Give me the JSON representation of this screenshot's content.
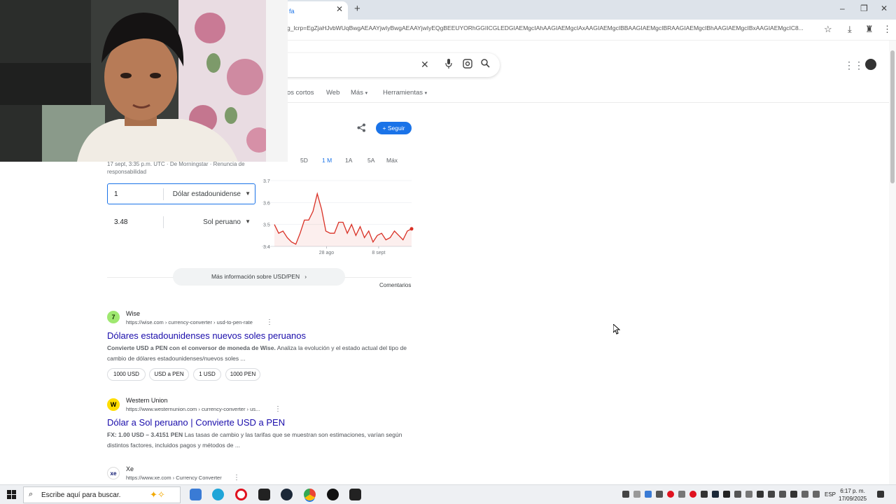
{
  "browser": {
    "tab_title": "fa",
    "url": "g_lcrp=EgZjaHJvbWUqBwgAEAAYjwIyBwgAEAAYjwIyEQgBEEUYORhGGIICGLEDGIAEMgcIAhAAGIAEMgcIAxAAGIAEMgcIBBAAGIAEMgcIBRAAGIAEMgcIBhAAGIAEMgcIBxAAGIAEMgcIC8..."
  },
  "search": {
    "filters": [
      "os cortos",
      "Web",
      "Más",
      "Herramientas"
    ],
    "follow_label": "Seguir"
  },
  "finance": {
    "ranges": [
      "5D",
      "1 M",
      "1A",
      "5A",
      "Máx"
    ],
    "active_range": "1 M",
    "disclaimer": "17 sept, 3:35 p.m. UTC · De Morningstar · Renuncia de responsabilidad",
    "from_amount": "1",
    "from_currency": "Dólar estadounidense",
    "to_amount": "3.48",
    "to_currency": "Sol peruano",
    "more_info": "Más información sobre USD/PEN",
    "comments": "Comentarios"
  },
  "chart_data": {
    "type": "line",
    "y_ticks": [
      "3.7",
      "3.6",
      "3.5",
      "3.4"
    ],
    "x_ticks": [
      "28 ago",
      "8 sept"
    ],
    "ylim": [
      3.4,
      3.7
    ],
    "color": "#d93025",
    "grid": true,
    "values": [
      3.5,
      3.46,
      3.47,
      3.44,
      3.42,
      3.41,
      3.46,
      3.52,
      3.52,
      3.56,
      3.64,
      3.57,
      3.47,
      3.46,
      3.46,
      3.51,
      3.51,
      3.46,
      3.5,
      3.45,
      3.49,
      3.44,
      3.47,
      3.42,
      3.45,
      3.46,
      3.43,
      3.44,
      3.47,
      3.45,
      3.43,
      3.47,
      3.48
    ]
  },
  "results": [
    {
      "site": "Wise",
      "logo": "7",
      "url": "https://wise.com › currency-converter › usd-to-pen-rate",
      "title": "Dólares estadounidenses nuevos soles peruanos",
      "snippet_bold": "Convierte USD a PEN con el conversor de moneda de Wise.",
      "snippet": " Analiza la evolución y el estado actual del tipo de cambio de dólares estadounidenses/nuevos soles ...",
      "chips": [
        "1000 USD",
        "USD a PEN",
        "1 USD",
        "1000 PEN"
      ]
    },
    {
      "site": "Western Union",
      "logo": "W",
      "url": "https://www.westernunion.com › currency-converter › us...",
      "title": "Dólar a Sol peruano | Convierte USD a PEN",
      "snippet_bold": "FX: 1.00 USD – 3.4151 PEN",
      "snippet": " Las tasas de cambio y las tarifas que se muestran son estimaciones, varían según distintos factores, incluidos pagos y métodos de ..."
    },
    {
      "site": "Xe",
      "logo": "xe",
      "url": "https://www.xe.com › Currency Converter"
    }
  ],
  "taskbar": {
    "search_placeholder": "Escribe aquí para buscar.",
    "lang": "ESP",
    "time": "6:17 p. m.",
    "date": "17/09/2025"
  },
  "colors": {
    "accent": "#1a73e8",
    "link": "#1a0dab",
    "chart_line": "#d93025"
  }
}
